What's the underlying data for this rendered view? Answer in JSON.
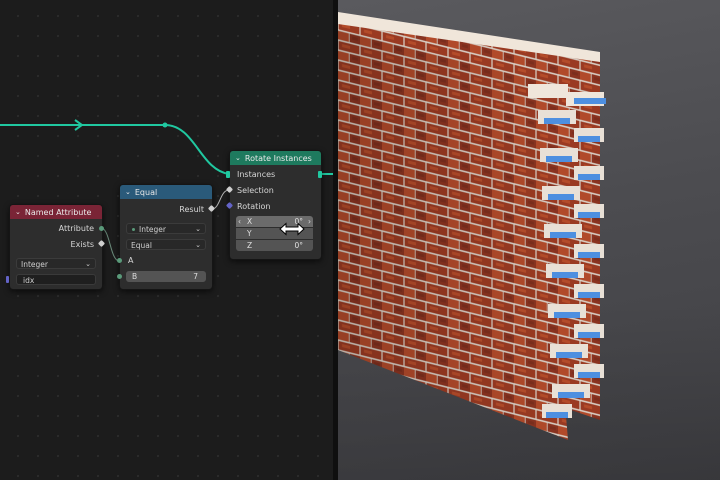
{
  "nodes": {
    "named_attribute": {
      "title": "Named Attribute",
      "header_color": "#7a2436",
      "outputs": [
        "Attribute",
        "Exists"
      ],
      "type_value": "Integer",
      "name_value": "idx"
    },
    "equal": {
      "title": "Equal",
      "header_color": "#2a5a7a",
      "output": "Result",
      "data_type": "Integer",
      "operation": "Equal",
      "input_a": "A",
      "input_b_label": "B",
      "input_b_value": "7"
    },
    "rotate_instances": {
      "title": "Rotate Instances",
      "header_color": "#1e7a5e",
      "inputs": [
        "Instances",
        "Selection",
        "Rotation"
      ],
      "rotation": [
        {
          "label": "X",
          "value": "0°"
        },
        {
          "label": "Y",
          "value": ""
        },
        {
          "label": "Z",
          "value": "0°"
        }
      ]
    }
  },
  "colors": {
    "geometry_link": "#20c8a0",
    "boolean_socket": "#cfcfcf",
    "integer_socket": "#5a9a7a",
    "vector_socket": "#6363c7"
  },
  "icons": [
    "chevron-down-icon",
    "resize-horizontal-cursor-icon"
  ]
}
